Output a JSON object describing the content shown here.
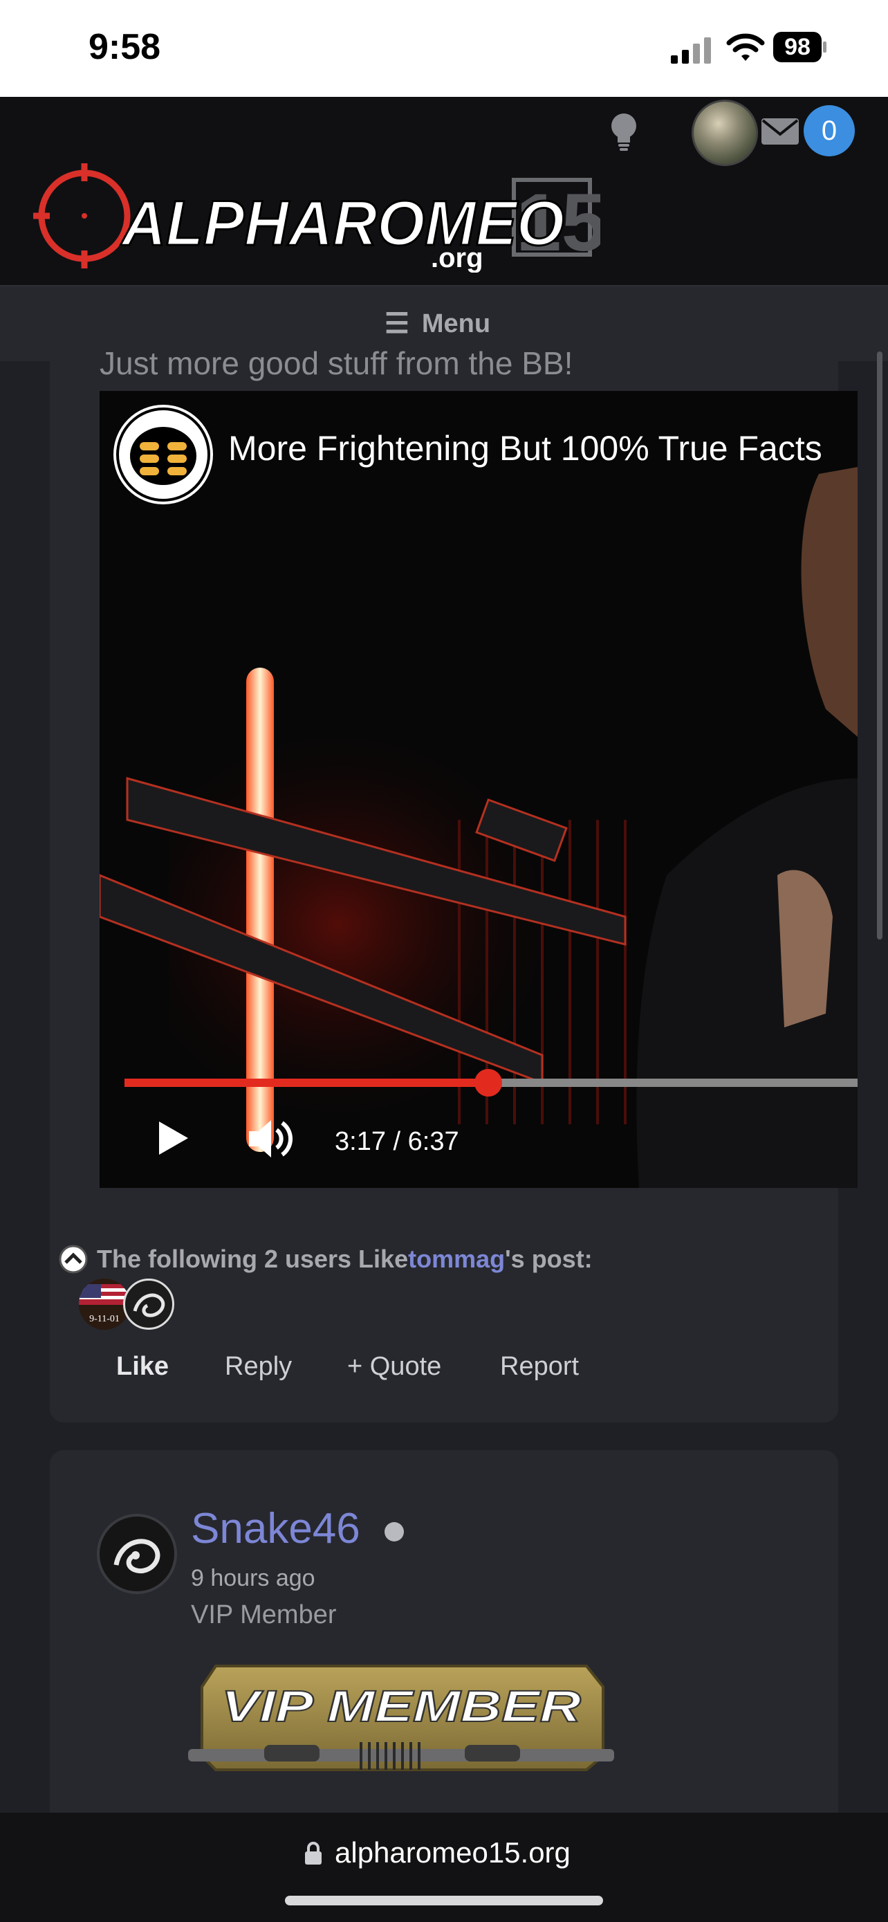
{
  "status_bar": {
    "time": "9:58",
    "battery": "98"
  },
  "header": {
    "logo_text": "ALPHAROMEO",
    "logo_number": "15",
    "logo_suffix": ".org",
    "notification_count": "0"
  },
  "nav": {
    "menu_label": "Menu",
    "menu_icon": "☰"
  },
  "post": {
    "text": "Just more good stuff from the BB!",
    "video": {
      "title": "More Frightening But 100% True Facts",
      "time_display": "3:17 / 6:37",
      "progress_fraction": 0.4962
    },
    "likes": {
      "prefix": "The following 2 users Like ",
      "user": "tommag",
      "suffix": "'s post:",
      "avatar_1_label": "9-11-01"
    },
    "actions": {
      "like": "Like",
      "reply": "Reply",
      "quote": "+ Quote",
      "report": "Report"
    }
  },
  "post2": {
    "username": "Snake46",
    "time": "9 hours ago",
    "user_title": "VIP Member",
    "badge_text": "VIP MEMBER"
  },
  "browser": {
    "url": "alpharomeo15.org"
  },
  "colors": {
    "accent_blue": "#3b8ee0",
    "link_purple": "#7d87d6",
    "video_red": "#e32a1f",
    "crosshair_red": "#d9302a"
  }
}
